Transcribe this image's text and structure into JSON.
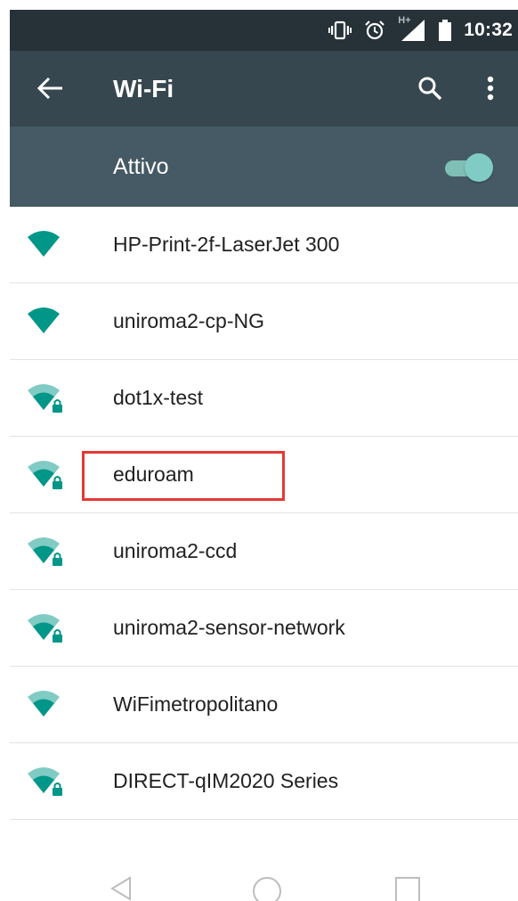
{
  "status_bar": {
    "time": "10:32",
    "icons": [
      "vibrate-icon",
      "alarm-icon",
      "signal-icon",
      "battery-icon"
    ],
    "network_type": "H+"
  },
  "app_bar": {
    "title": "Wi-Fi",
    "back_icon": "arrow-back-icon",
    "search_icon": "search-icon",
    "more_icon": "more-vert-icon"
  },
  "master_switch": {
    "label": "Attivo",
    "state": "on"
  },
  "networks": [
    {
      "name": "HP-Print-2f-LaserJet 300",
      "secured": false,
      "signal": 4
    },
    {
      "name": "uniroma2-cp-NG",
      "secured": false,
      "signal": 4
    },
    {
      "name": "dot1x-test",
      "secured": true,
      "signal": 3
    },
    {
      "name": "eduroam",
      "secured": true,
      "signal": 3
    },
    {
      "name": "uniroma2-ccd",
      "secured": true,
      "signal": 3
    },
    {
      "name": "uniroma2-sensor-network",
      "secured": true,
      "signal": 3
    },
    {
      "name": "WiFimetropolitano",
      "secured": false,
      "signal": 3
    },
    {
      "name": "DIRECT-qIM2020 Series",
      "secured": true,
      "signal": 3
    }
  ],
  "highlighted_network": "eduroam",
  "nav_bar": {
    "icons": [
      "back-triangle-icon",
      "home-circle-icon",
      "recents-square-icon"
    ]
  },
  "colors": {
    "status_bar": "#263238",
    "app_bar": "#37474f",
    "master_bar": "#455a64",
    "accent": "#009688",
    "accent_light": "#80cbc4",
    "highlight": "#e53935"
  }
}
